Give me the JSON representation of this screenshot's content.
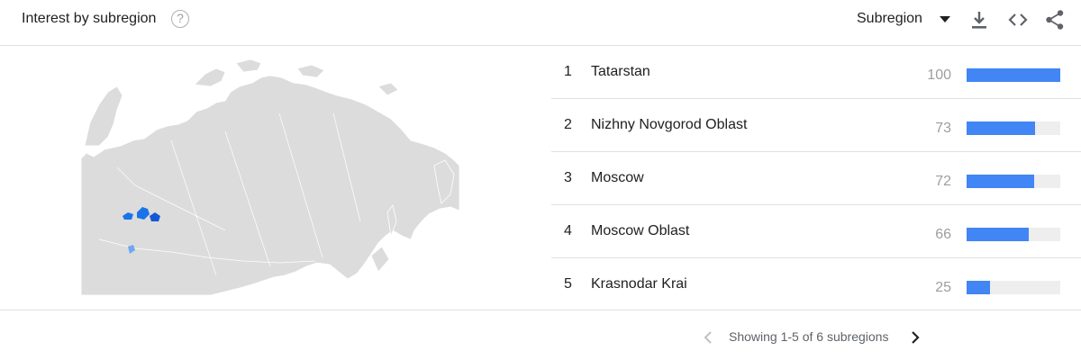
{
  "header": {
    "title": "Interest by subregion",
    "help_glyph": "?",
    "dropdown_label": "Subregion",
    "icons": [
      "help-icon",
      "chevron-down-icon",
      "download-icon",
      "embed-icon",
      "share-icon"
    ]
  },
  "colors": {
    "bar": "#4285f4",
    "bar_track": "#eeeeee",
    "map_land": "#dcdcdc",
    "map_highlight": "#1a73e8",
    "map_highlight_light": "#6fa8f0"
  },
  "regions": [
    {
      "rank": "1",
      "name": "Tatarstan",
      "value": "100",
      "fraction": 1.0
    },
    {
      "rank": "2",
      "name": "Nizhny Novgorod Oblast",
      "value": "73",
      "fraction": 0.73
    },
    {
      "rank": "3",
      "name": "Moscow",
      "value": "72",
      "fraction": 0.72
    },
    {
      "rank": "4",
      "name": "Moscow Oblast",
      "value": "66",
      "fraction": 0.66
    },
    {
      "rank": "5",
      "name": "Krasnodar Krai",
      "value": "25",
      "fraction": 0.25
    }
  ],
  "pager": {
    "text": "Showing 1-5 of 6 subregions"
  }
}
